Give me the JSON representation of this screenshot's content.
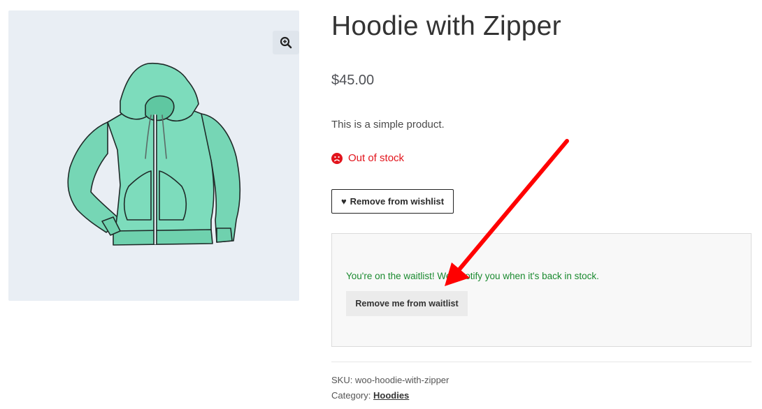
{
  "product": {
    "title": "Hoodie with Zipper",
    "price": "$45.00",
    "description": "This is a simple product.",
    "stock_status": "Out of stock",
    "stock_icon": "sad-face-icon",
    "image_alt": "Hoodie with Zipper"
  },
  "gallery": {
    "zoom_icon": "magnifier-zoom-icon"
  },
  "wishlist": {
    "heart": "♥",
    "button_label": "Remove from wishlist"
  },
  "waitlist": {
    "message": "You're on the waitlist! We'll notify you when it's back in stock.",
    "button_label": "Remove me from waitlist"
  },
  "meta": {
    "sku_label": "SKU:",
    "sku_value": "woo-hoodie-with-zipper",
    "category_label": "Category:",
    "category_value": "Hoodies"
  },
  "colors": {
    "out_of_stock": "#e2141c",
    "waitlist_success": "#1a8a2f",
    "hoodie": "#7ddcbc",
    "annotation_arrow": "#ff0000"
  }
}
